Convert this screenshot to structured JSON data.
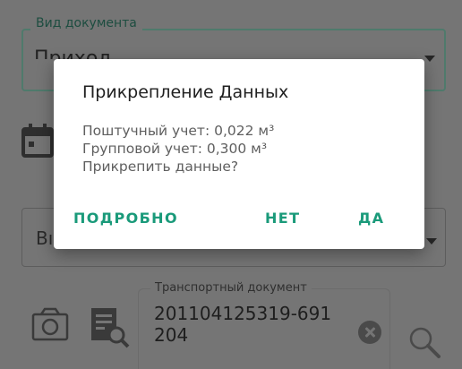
{
  "form": {
    "doc_type_label": "Вид документа",
    "doc_type_value": "Приход",
    "second_field_text": "Вı",
    "transport_label": "Транспортный документ",
    "transport_value": "201104125319-691 204"
  },
  "dialog": {
    "title": "Прикрепление Данных",
    "lines": [
      "Поштучный учет: 0,022 м³",
      "Групповой учет: 0,300 м³",
      "Прикрепить данные?"
    ],
    "buttons": {
      "details": "ПОДРОБНО",
      "no": "НЕТ",
      "yes": "ДА"
    }
  },
  "colors": {
    "accent": "#1a9a7a",
    "scrim": "#757575",
    "dialog_bg": "#ffffff"
  }
}
